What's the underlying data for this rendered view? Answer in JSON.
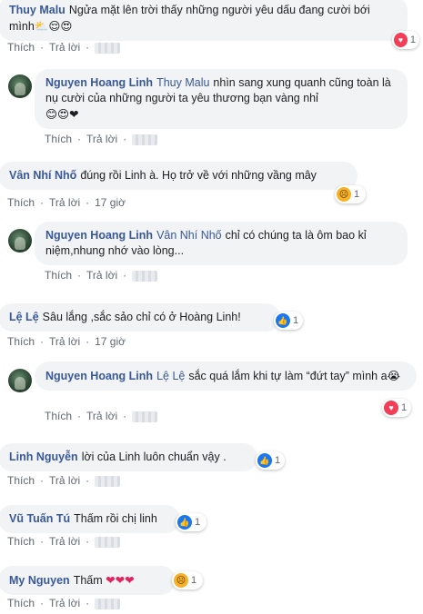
{
  "comments": [
    {
      "name": "Thuy Malu",
      "text": "Ngửa mặt lên trời thấy những người yêu dấu đang cười bới mình",
      "emoji": "⛅😌😍",
      "like": "Thích",
      "reply": "Trả lời",
      "time": "",
      "reaction": {
        "type": "love",
        "count": "1"
      }
    },
    {
      "name": "Nguyen Hoang Linh",
      "tag": "Thuy Malu",
      "text": "nhìn sang xung quanh cũng toàn là nụ cười của những người ta yêu thương bạn vàng nhỉ",
      "emoji": "😊😍❤",
      "like": "Thích",
      "reply": "Trả lời",
      "time": ""
    },
    {
      "name": "Vân Nhí Nhố",
      "text": "đúng rồi Linh à. Họ trở về với những vầng mây",
      "like": "Thích",
      "reply": "Trả lời",
      "time": "17 giờ",
      "reaction": {
        "type": "sad",
        "count": "1"
      }
    },
    {
      "name": "Nguyen Hoang Linh",
      "tag": "Vân Nhí Nhố",
      "text": "chỉ có chúng ta là ôm bao kỉ niệm,nhung nhớ vào lòng...",
      "like": "Thích",
      "reply": "Trả lời",
      "time": ""
    },
    {
      "name": "Lệ Lệ",
      "text": "Sâu lắng ,sắc sảo chỉ có ở Hoàng Linh!",
      "like": "Thích",
      "reply": "Trả lời",
      "time": "17 giờ",
      "reaction": {
        "type": "like",
        "count": "1"
      }
    },
    {
      "name": "Nguyen Hoang Linh",
      "tag": "Lệ Lệ",
      "text": "sắc quá lắm khi tự làm “đứt tay” mình a",
      "emoji": "😭",
      "like": "Thích",
      "reply": "Trả lời",
      "time": "",
      "reaction": {
        "type": "love",
        "count": "1"
      }
    },
    {
      "name": "Linh Nguyễn",
      "text": "lời của Linh luôn chuẩn vậy .",
      "like": "Thích",
      "reply": "Trả lời",
      "time": "",
      "reaction": {
        "type": "like",
        "count": "1"
      }
    },
    {
      "name": "Vũ Tuấn Tú",
      "text": "Thấm rồi chị linh",
      "like": "Thích",
      "reply": "Trả lời",
      "time": "",
      "reaction": {
        "type": "like",
        "count": "1"
      }
    },
    {
      "name": "My Nguyen",
      "text": "Thấm",
      "emoji": "❤❤❤",
      "like": "Thích",
      "reply": "Trả lời",
      "time": "",
      "reaction": {
        "type": "sad",
        "count": "1"
      }
    }
  ],
  "colors": {
    "link": "#385898",
    "bubble": "#f2f3f5",
    "like": "#1877f2",
    "love": "#f33e58",
    "sad": "#f7b125"
  }
}
